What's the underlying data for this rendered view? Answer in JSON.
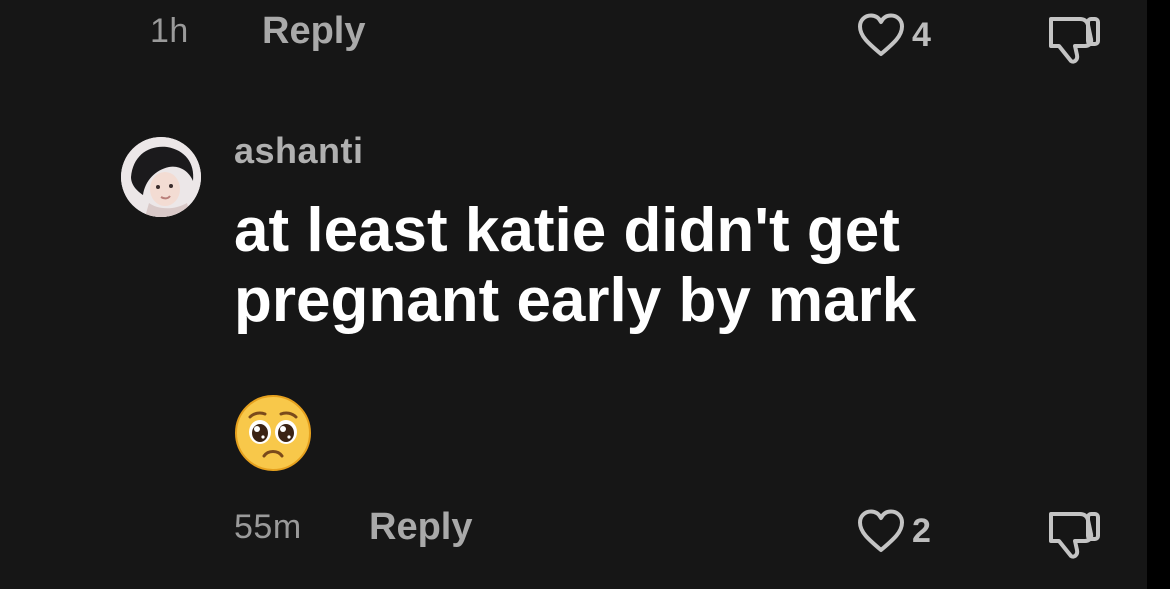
{
  "previous_comment": {
    "time": "1h",
    "reply_label": "Reply",
    "like_count": "4",
    "like_icon": "heart-outline-icon",
    "dislike_icon": "thumbs-down-icon"
  },
  "comment": {
    "avatar_icon": "user-avatar",
    "username": "ashanti",
    "text": "at least katie didn't get pregnant early by mark",
    "emoji": "pleading-face-emoji",
    "time": "55m",
    "reply_label": "Reply",
    "like_count": "2",
    "like_icon": "heart-outline-icon",
    "dislike_icon": "thumbs-down-icon"
  },
  "colors": {
    "background": "#161616",
    "comment_text": "#ffffff",
    "muted_text": "#9a9a9a",
    "reply_text": "#a9a9a9"
  }
}
